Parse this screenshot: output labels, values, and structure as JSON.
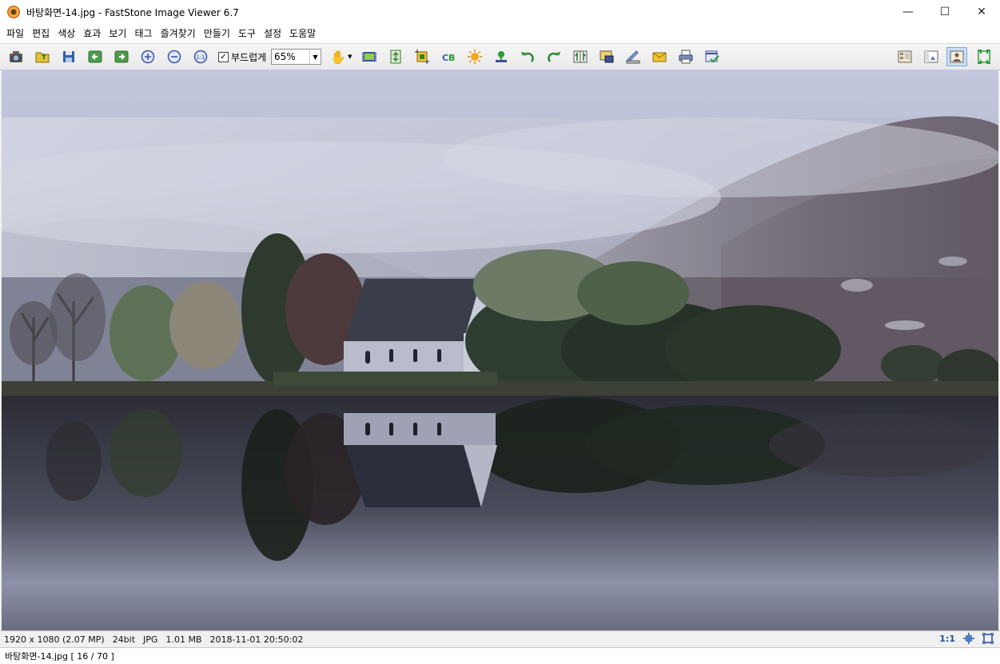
{
  "window": {
    "title": "바탕화면-14.jpg  -  FastStone Image Viewer 6.7",
    "minimize": "—",
    "maximize": "☐",
    "close": "✕"
  },
  "menu": [
    "파일",
    "편집",
    "색상",
    "효과",
    "보기",
    "태그",
    "즐겨찾기",
    "만들기",
    "도구",
    "설정",
    "도움말"
  ],
  "toolbar": {
    "smooth_label": "부드럽게",
    "smooth_checked": "✓",
    "zoom_value": "65%",
    "zoom_arrow": "▼",
    "hand_icon": "✋",
    "hand_arrow": "▼",
    "icons": [
      "camera-icon",
      "open-folder-icon",
      "save-icon",
      "prev-icon",
      "next-icon",
      "zoom-in-icon",
      "zoom-out-icon",
      "actual-size-icon",
      "slideshow-icon",
      "resize-icon",
      "crop-icon",
      "color-cb-icon",
      "sun-adjust-icon",
      "stamp-icon",
      "rotate-left-icon",
      "rotate-right-icon",
      "flip-icon",
      "screen-capture-icon",
      "scanner-icon",
      "email-icon",
      "print-icon",
      "tag-check-icon"
    ],
    "right_icons": [
      "thumbnail-layout-icon",
      "browser-layout-icon",
      "viewer-layout-icon",
      "fullscreen-icon"
    ]
  },
  "image": {
    "description_colors": {
      "sky": "#c9cde0",
      "mist": "#a8abbe",
      "water": "#2e2f3a"
    }
  },
  "status": {
    "dimensions": "1920 x 1080 (2.07 MP)",
    "bit": "24bit",
    "format": "JPG",
    "size": "1.01 MB",
    "datetime": "2018-11-01 20:50:02",
    "ratio": "1:1"
  },
  "filebar": {
    "text": "바탕화면-14.jpg [ 16 / 70 ]"
  }
}
